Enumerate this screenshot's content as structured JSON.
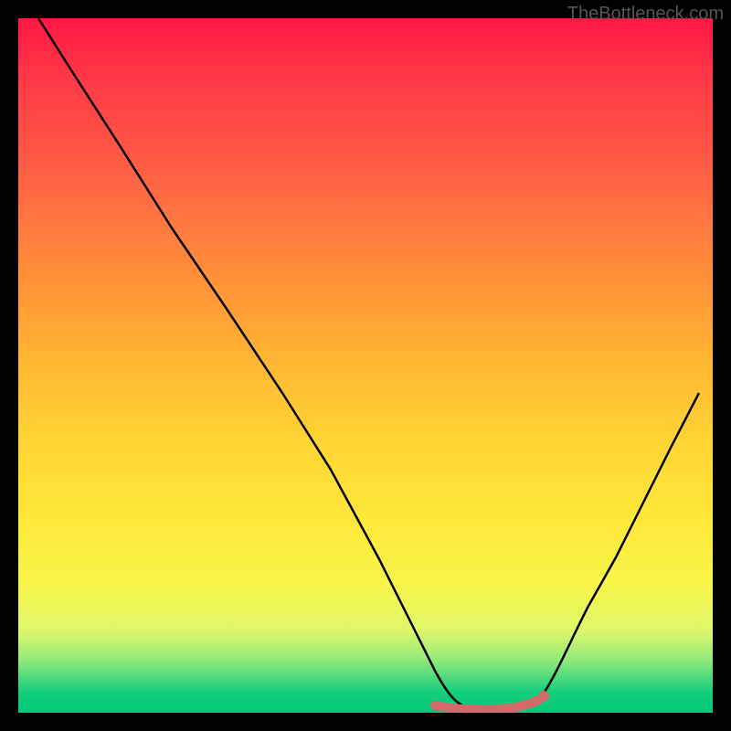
{
  "watermark": "TheBottleneck.com",
  "chart_data": {
    "type": "line",
    "title": "",
    "xlabel": "",
    "ylabel": "",
    "xlim": [
      0,
      100
    ],
    "ylim": [
      0,
      100
    ],
    "x": [
      3,
      8,
      15,
      22,
      30,
      38,
      45,
      52,
      57,
      60,
      63,
      66,
      69,
      72,
      75,
      78,
      82,
      86,
      90,
      94,
      98
    ],
    "y": [
      100,
      92,
      81,
      70,
      58,
      46,
      35,
      22,
      12,
      6,
      2,
      0.5,
      0.2,
      0.5,
      1,
      4,
      10,
      17,
      25,
      33,
      40
    ],
    "optimal_zone": {
      "x_start": 60,
      "x_end": 76,
      "y": 0.5
    },
    "marker_point": {
      "x": 76,
      "y": 1.5
    },
    "annotations": []
  },
  "colors": {
    "curve": "#000000",
    "marker_stroke": "#d36a6a",
    "marker_fill": "#d36a6a",
    "gradient_top": "#ff1744",
    "gradient_bottom": "#00c97a"
  }
}
